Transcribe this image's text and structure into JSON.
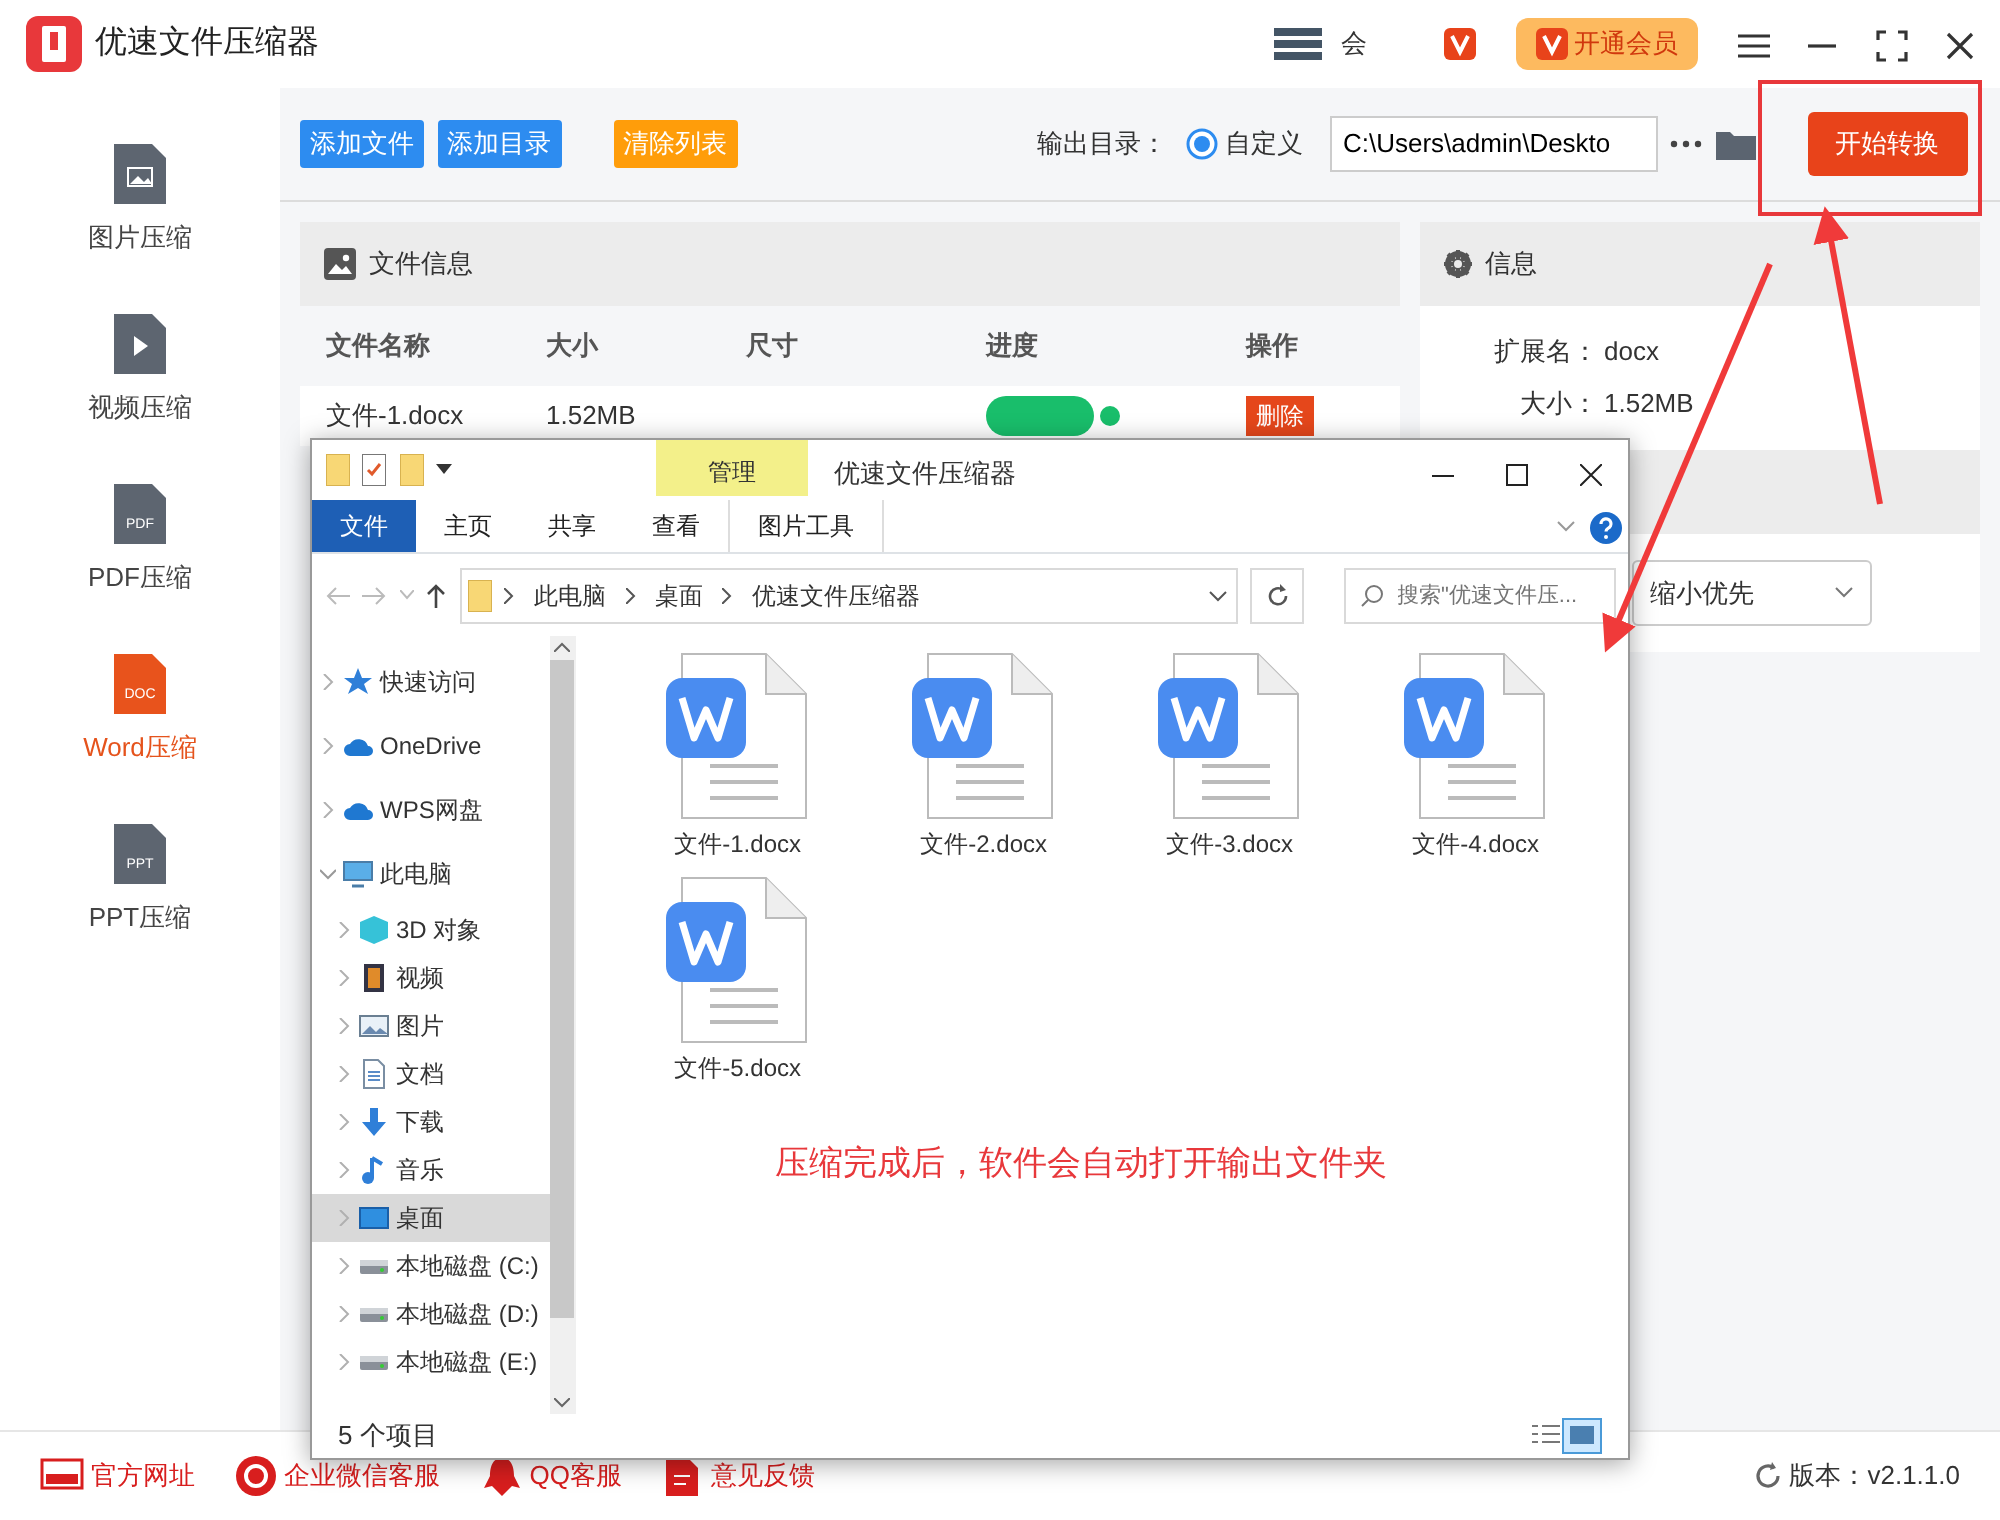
{
  "app": {
    "title": "优速文件压缩器",
    "account_text": "会",
    "vip_button": "开通会员"
  },
  "toolbar": {
    "buttons": [
      {
        "label": "添加文件",
        "kind": "primary"
      },
      {
        "label": "添加目录",
        "kind": "primary"
      },
      {
        "label": "清除列表",
        "kind": "warning"
      }
    ],
    "output_label": "输出目录：",
    "output_option": {
      "label": "自定义",
      "selected": true
    },
    "output_path": "C:\\Users\\admin\\Deskto",
    "start_button": "开始转换"
  },
  "sidebar": {
    "items": [
      {
        "label": "图片压缩",
        "kind": "image",
        "selected": false
      },
      {
        "label": "视频压缩",
        "kind": "video",
        "selected": false
      },
      {
        "label": "PDF压缩",
        "kind": "doc",
        "icon_label": "PDF",
        "selected": false
      },
      {
        "label": "Word压缩",
        "kind": "doc",
        "icon_label": "DOC",
        "selected": true
      },
      {
        "label": "PPT压缩",
        "kind": "doc",
        "icon_label": "PPT",
        "selected": false
      }
    ]
  },
  "file_panel": {
    "title": "文件信息",
    "columns": [
      "文件名称",
      "大小",
      "尺寸",
      "进度",
      "操作"
    ],
    "rows": [
      {
        "name": "文件-1.docx",
        "size": "1.52MB",
        "action": "删除"
      }
    ]
  },
  "info_panel": {
    "title": "信息",
    "fields": [
      {
        "label": "扩展名：",
        "value": "docx"
      },
      {
        "label": "大小：",
        "value": "1.52MB"
      }
    ],
    "mode": "缩小优先"
  },
  "explorer": {
    "title": "优速文件压缩器",
    "context_tab": "管理",
    "ribbon_tabs": [
      {
        "label": "文件",
        "selected": true
      },
      {
        "label": "主页",
        "selected": false
      },
      {
        "label": "共享",
        "selected": false
      },
      {
        "label": "查看",
        "selected": false
      },
      {
        "label": "图片工具",
        "selected": false
      }
    ],
    "breadcrumb": [
      "此电脑",
      "桌面",
      "优速文件压缩器"
    ],
    "search": {
      "placeholder": "搜索\"优速文件压..."
    },
    "nav": [
      {
        "label": "快速访问",
        "kind": "star",
        "expanded": false,
        "selected": false
      },
      {
        "label": "OneDrive",
        "kind": "cloud",
        "expanded": false,
        "selected": false
      },
      {
        "label": "WPS网盘",
        "kind": "cloud",
        "expanded": false,
        "selected": false
      },
      {
        "label": "此电脑",
        "kind": "pc",
        "expanded": true,
        "selected": false,
        "children": [
          {
            "label": "3D 对象",
            "kind": "cube",
            "expanded": false,
            "selected": false
          },
          {
            "label": "视频",
            "kind": "film",
            "expanded": false,
            "selected": false
          },
          {
            "label": "图片",
            "kind": "pic",
            "expanded": false,
            "selected": false
          },
          {
            "label": "文档",
            "kind": "doc",
            "expanded": false,
            "selected": false
          },
          {
            "label": "下载",
            "kind": "down",
            "expanded": false,
            "selected": false
          },
          {
            "label": "音乐",
            "kind": "music",
            "expanded": false,
            "selected": false
          },
          {
            "label": "桌面",
            "kind": "desk",
            "expanded": false,
            "selected": true
          },
          {
            "label": "本地磁盘 (C:)",
            "kind": "drive",
            "expanded": false,
            "selected": false
          },
          {
            "label": "本地磁盘 (D:)",
            "kind": "drive",
            "expanded": false,
            "selected": false
          },
          {
            "label": "本地磁盘 (E:)",
            "kind": "drive",
            "expanded": false,
            "selected": false
          }
        ]
      }
    ],
    "files": [
      {
        "name": "文件-1.docx"
      },
      {
        "name": "文件-2.docx"
      },
      {
        "name": "文件-3.docx"
      },
      {
        "name": "文件-4.docx"
      },
      {
        "name": "文件-5.docx"
      }
    ],
    "note": "压缩完成后，软件会自动打开输出文件夹",
    "status": "5 个项目"
  },
  "footer": {
    "links": [
      {
        "label": "官方网址",
        "kind": "web"
      },
      {
        "label": "企业微信客服",
        "kind": "chat"
      },
      {
        "label": "QQ客服",
        "kind": "qq"
      },
      {
        "label": "意见反馈",
        "kind": "feedback"
      }
    ],
    "version": "版本：v2.1.1.0"
  }
}
